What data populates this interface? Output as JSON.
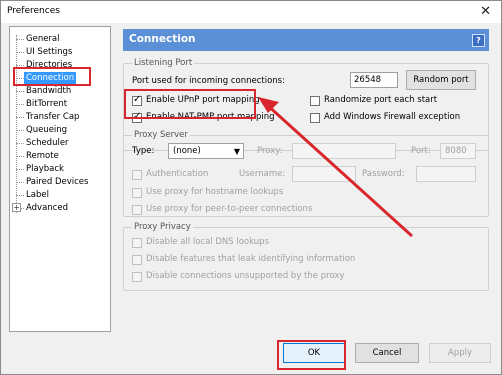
{
  "window": {
    "title": "Preferences",
    "close_glyph": "✕"
  },
  "tree": {
    "items": [
      {
        "label": "General"
      },
      {
        "label": "UI Settings"
      },
      {
        "label": "Directories"
      },
      {
        "label": "Connection"
      },
      {
        "label": "Bandwidth"
      },
      {
        "label": "BitTorrent"
      },
      {
        "label": "Transfer Cap"
      },
      {
        "label": "Queueing"
      },
      {
        "label": "Scheduler"
      },
      {
        "label": "Remote"
      },
      {
        "label": "Playback"
      },
      {
        "label": "Paired Devices"
      },
      {
        "label": "Label"
      },
      {
        "label": "Advanced"
      }
    ],
    "selected": "Connection",
    "expander_glyph": "+"
  },
  "panel": {
    "title": "Connection",
    "help_glyph": "?",
    "listening_port": {
      "group_label": "Listening Port",
      "port_label": "Port used for incoming connections:",
      "port_value": "26548",
      "random_port_button": "Random port",
      "enable_upnp": {
        "label": "Enable UPnP port mapping",
        "checked": true
      },
      "randomize_port": {
        "label": "Randomize port each start",
        "checked": false
      },
      "enable_nat_pmp": {
        "label": "Enable NAT-PMP port mapping",
        "checked": true
      },
      "add_firewall_exception": {
        "label": "Add Windows Firewall exception",
        "checked": false
      }
    },
    "proxy_server": {
      "group_label": "Proxy Server",
      "type_label": "Type:",
      "type_value": "(none)",
      "proxy_label": "Proxy:",
      "proxy_value": "",
      "port_label": "Port:",
      "port_value": "8080",
      "authentication": {
        "label": "Authentication",
        "checked": false
      },
      "username_label": "Username:",
      "password_label": "Password:",
      "hostname_lookups": {
        "label": "Use proxy for hostname lookups",
        "checked": false
      },
      "peer_connections": {
        "label": "Use proxy for peer-to-peer connections",
        "checked": false
      }
    },
    "proxy_privacy": {
      "group_label": "Proxy Privacy",
      "disable_dns": {
        "label": "Disable all local DNS lookups",
        "checked": false
      },
      "disable_leak": {
        "label": "Disable features that leak identifying information",
        "checked": false
      },
      "disable_unsupported": {
        "label": "Disable connections unsupported by the proxy",
        "checked": false
      }
    }
  },
  "buttons": {
    "ok": "OK",
    "cancel": "Cancel",
    "apply": "Apply"
  },
  "colors": {
    "accent": "#5b8fd6",
    "highlight": "#d9262c",
    "selection": "#3399ff"
  }
}
